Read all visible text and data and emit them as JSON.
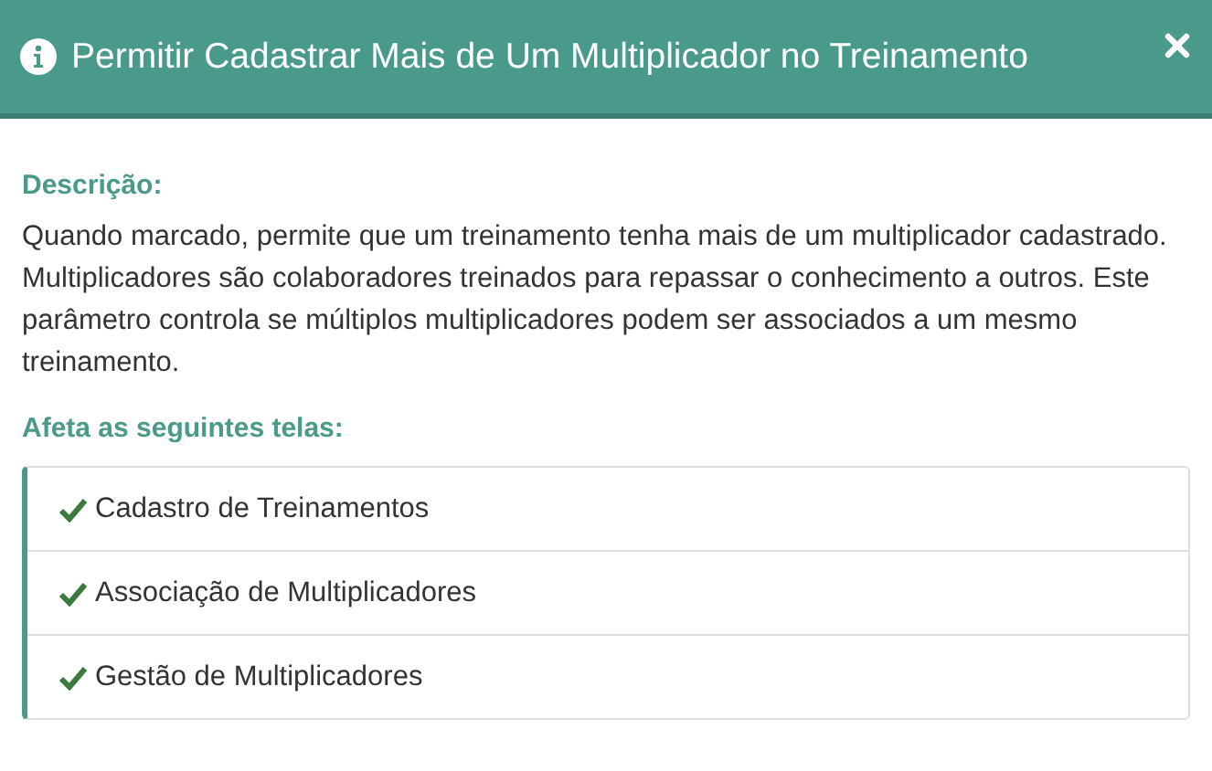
{
  "header": {
    "title": "Permitir Cadastrar Mais de Um Multiplicador no Treinamento"
  },
  "description": {
    "label": "Descrição:",
    "text": "Quando marcado, permite que um treinamento tenha mais de um multiplicador cadastrado. Multiplicadores são colaboradores treinados para repassar o conhecimento a outros. Este parâmetro controla se múltiplos multiplicadores podem ser associados a um mesmo treinamento."
  },
  "affected": {
    "label": "Afeta as seguintes telas:",
    "items": [
      {
        "label": "Cadastro de Treinamentos"
      },
      {
        "label": "Associação de Multiplicadores"
      },
      {
        "label": "Gestão de Multiplicadores"
      }
    ]
  }
}
